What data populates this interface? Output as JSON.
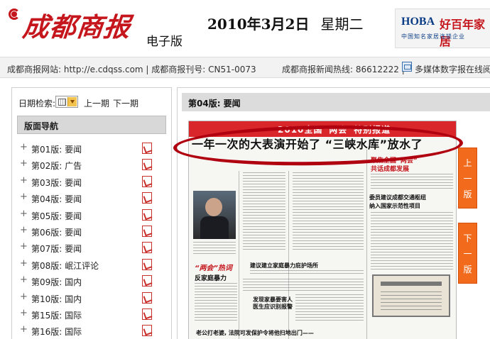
{
  "header": {
    "logo_title": "成都商报",
    "logo_sub": "电子版",
    "date": "2010年3月2日",
    "weekday": "星期二",
    "ad": {
      "brand": "HOBA",
      "brand_cn": "好百年家居",
      "sub": "中国知名家居连锁企业"
    }
  },
  "infobar": {
    "left": "成都商报网站: http://e.cdqss.com | 成都商报刊号: CN51-0073",
    "right": "成都商报新闻热线: 86612222 |",
    "multimedia": "多媒体数字报在线阅"
  },
  "sidebar": {
    "date_label": "日期检索:",
    "prev": "上一期",
    "next": "下一期",
    "nav_title": "版面导航",
    "items": [
      {
        "label": "第01版: 要闻"
      },
      {
        "label": "第02版: 广告"
      },
      {
        "label": "第03版: 要闻"
      },
      {
        "label": "第04版: 要闻"
      },
      {
        "label": "第05版: 要闻"
      },
      {
        "label": "第06版: 要闻"
      },
      {
        "label": "第07版: 要闻"
      },
      {
        "label": "第08版: 岷江评论"
      },
      {
        "label": "第09版: 国内"
      },
      {
        "label": "第10版: 国内"
      },
      {
        "label": "第15版: 国际"
      },
      {
        "label": "第16版: 国际"
      }
    ]
  },
  "main": {
    "page_title": "第04版: 要闻",
    "headline": "一年一次的大表演开始了 “三峡水库”放水了",
    "paper_banner": "2010全国“两会”特别报道",
    "paper_heads": [
      "聚焦全国“两会”",
      "共话成都发展",
      "委员建议成都交通枢纽",
      "纳入国家示范性项目",
      "“两会”热词",
      "建议建立家庭暴力庇护场所",
      "反家庭暴力",
      "发现家暴要害人",
      "医生应识别报警",
      "老公打老婆, 法院可发保护令将他扫地出门——"
    ],
    "side_up": [
      "上",
      "一",
      "版"
    ],
    "side_down": [
      "下",
      "一",
      "版"
    ]
  },
  "colors": {
    "brand_red": "#c4161c",
    "side_button": "#f26b1c",
    "nav_header": "#d8d8d8"
  }
}
